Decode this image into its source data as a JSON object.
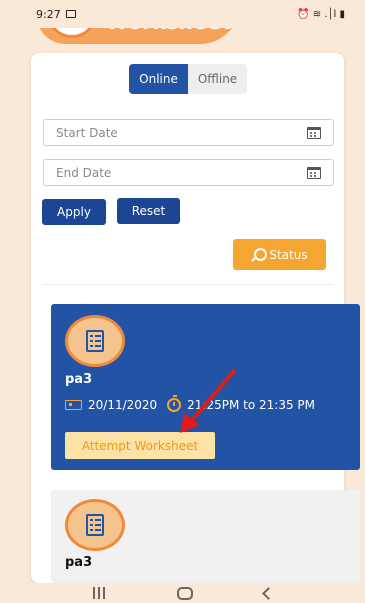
{
  "status_bar": {
    "time": "9:27",
    "icons": [
      "image-icon",
      "alarm-icon",
      "wifi-icon",
      "signal-icon",
      "battery-icon"
    ],
    "right_text": "⏰ ≋ .│l ▮"
  },
  "header": {
    "title": "Worksheet",
    "color": "#f5a25a"
  },
  "mode_toggle": {
    "online_label": "Online",
    "offline_label": "Offline",
    "selected": "Online"
  },
  "filters": {
    "start_date_placeholder": "Start Date",
    "end_date_placeholder": "End Date",
    "apply_label": "Apply",
    "reset_label": "Reset",
    "status_label": "Status"
  },
  "worksheets": [
    {
      "name": "pa3",
      "date": "20/11/2020",
      "time": "21:25PM to 21:35 PM",
      "action_label": "Attempt Worksheet",
      "active": true
    },
    {
      "name": "pa3",
      "active": false
    }
  ],
  "colors": {
    "primary": "#2353a5",
    "accent": "#f5a531",
    "background": "#fbe9d8"
  },
  "nav_bar": {
    "icons": [
      "recent-apps-icon",
      "home-icon",
      "back-icon"
    ]
  }
}
